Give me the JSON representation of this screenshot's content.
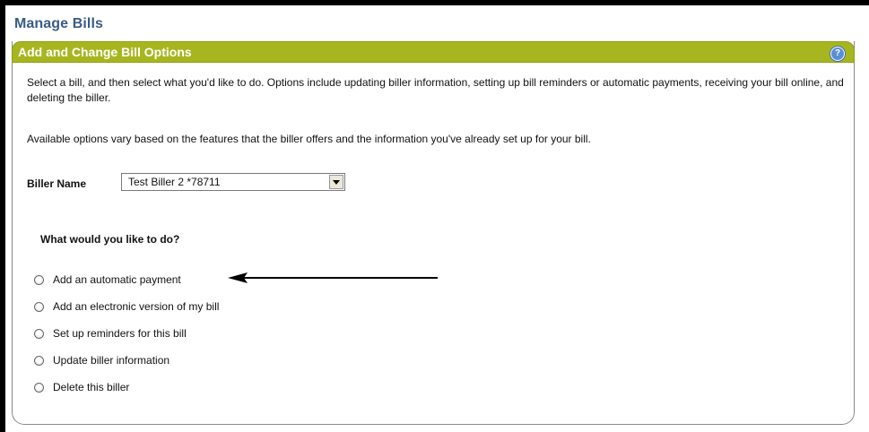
{
  "page_title": "Manage Bills",
  "panel": {
    "title": "Add and Change Bill Options",
    "help_icon_glyph": "?"
  },
  "description": {
    "paragraph1": "Select a bill, and then select what you'd like to do. Options include updating biller information, setting up bill reminders or automatic payments, receiving your bill online, and deleting the biller.",
    "paragraph2": "Available options vary based on the features that the biller offers and the information you've already set up for your bill."
  },
  "biller": {
    "label": "Biller Name",
    "selected": "Test Biller 2 *78711"
  },
  "question": "What would you like to do?",
  "options": [
    {
      "label": "Add an automatic payment"
    },
    {
      "label": "Add an electronic version of my bill"
    },
    {
      "label": "Set up reminders for this bill"
    },
    {
      "label": "Update biller information"
    },
    {
      "label": "Delete this biller"
    }
  ],
  "colors": {
    "header_bg": "#a7b61f",
    "title_blue": "#3a5b86",
    "help_blue": "#5a8fd6"
  }
}
